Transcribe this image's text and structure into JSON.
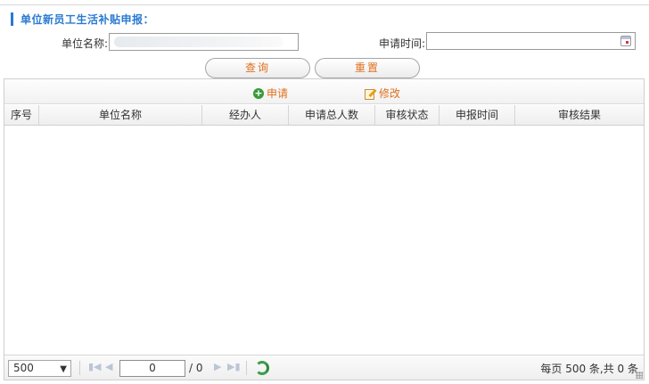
{
  "section": {
    "title": "单位新员工生活补贴申报："
  },
  "form": {
    "unit_name_label": "单位名称:",
    "unit_name_value": "",
    "apply_time_label": "申请时间:",
    "apply_time_value": ""
  },
  "buttons": {
    "query": "查询",
    "reset": "重置"
  },
  "toolbar": {
    "apply": "申请",
    "edit": "修改"
  },
  "table": {
    "columns": [
      "序号",
      "单位名称",
      "经办人",
      "申请总人数",
      "审核状态",
      "申报时间",
      "审核结果"
    ],
    "rows": []
  },
  "pager": {
    "page_size": "500",
    "current_page": "0",
    "total_pages": "/ 0",
    "summary": "每页 500 条,共 0 条"
  },
  "icons": {
    "apply": "plus-circle-icon",
    "edit": "pencil-icon",
    "calendar": "calendar-icon",
    "refresh": "refresh-icon"
  },
  "colors": {
    "accent": "#2a7ad2",
    "button_text": "#e0701e",
    "refresh": "#3aa04a"
  }
}
